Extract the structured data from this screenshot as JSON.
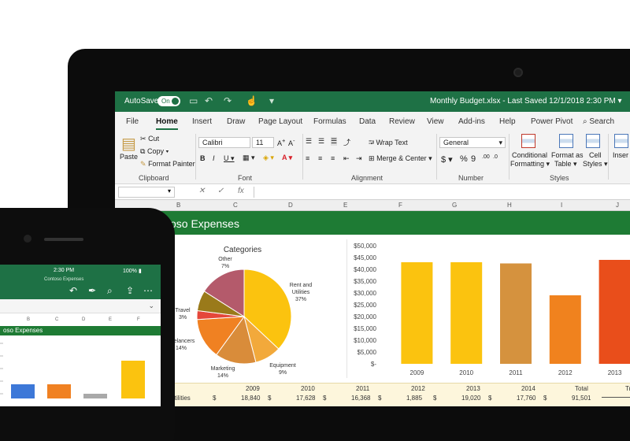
{
  "laptop": {
    "titlebar": {
      "autosave_label": "AutoSave",
      "autosave_state": "On",
      "document_title": "Monthly Budget.xlsx  -  Last Saved 12/1/2018 2:30 PM"
    },
    "tabs": [
      "File",
      "Home",
      "Insert",
      "Draw",
      "Page Layout",
      "Formulas",
      "Data",
      "Review",
      "View",
      "Add-ins",
      "Help",
      "Power Pivot"
    ],
    "active_tab": "Home",
    "search_label": "Search",
    "ribbon": {
      "clipboard": {
        "group": "Clipboard",
        "paste": "Paste",
        "cut": "Cut",
        "copy": "Copy",
        "format_painter": "Format Painter"
      },
      "font": {
        "group": "Font",
        "font_name": "Calibri",
        "font_size": "11"
      },
      "alignment": {
        "group": "Alignment",
        "wrap_text": "Wrap Text",
        "merge_center": "Merge & Center"
      },
      "number": {
        "group": "Number",
        "format": "General"
      },
      "styles": {
        "group": "Styles",
        "conditional": "Conditional",
        "formatting": "Formatting",
        "format_as": "Format as",
        "table": "Table",
        "cell": "Cell",
        "cell_styles": "Styles",
        "insert": "Inser"
      }
    },
    "column_headers": [
      "B",
      "C",
      "D",
      "E",
      "F",
      "G",
      "H",
      "I",
      "J"
    ],
    "banner_title": "oso Expenses",
    "pie": {
      "title": "Categories",
      "labels": [
        "Other",
        "7%",
        "Rent and",
        "Utilities",
        "37%",
        "Equipment",
        "9%",
        "Marketing",
        "14%",
        "elancers",
        "14%",
        "Travel",
        "3%"
      ]
    },
    "table": {
      "years": [
        "2009",
        "2010",
        "2011",
        "2012",
        "2013",
        "2014",
        "Total",
        "Tr"
      ],
      "row_label": "Utilities",
      "row_values": [
        "18,840",
        "17,628",
        "16,368",
        "1,885",
        "19,020",
        "17,760",
        "91,501"
      ],
      "currency": "$"
    }
  },
  "phone": {
    "time": "2:30 PM",
    "battery": "100%",
    "file_name": "Contoso Expenses",
    "column_headers": [
      "B",
      "C",
      "D",
      "E",
      "F"
    ],
    "banner_title": "oso Expenses"
  },
  "chart_data": {
    "type": "bar",
    "categories": [
      "2009",
      "2010",
      "2011",
      "2012",
      "2013"
    ],
    "values": [
      43000,
      43000,
      42500,
      29000,
      44000
    ],
    "colors": [
      "#fbc30f",
      "#fbc30f",
      "#d5923e",
      "#f0821e",
      "#e94e1b"
    ],
    "y_ticks": [
      "$-",
      "$5,000",
      "$10,000",
      "$15,000",
      "$20,000",
      "$25,000",
      "$30,000",
      "$35,000",
      "$40,000",
      "$45,000",
      "$50,000"
    ],
    "ylim": [
      0,
      50000
    ],
    "pie_slices": [
      {
        "label": "Rent and Utilities",
        "value": 37,
        "color": "#fbc30f"
      },
      {
        "label": "Equipment",
        "value": 9,
        "color": "#f2a93b"
      },
      {
        "label": "Marketing",
        "value": 14,
        "color": "#d98c3a"
      },
      {
        "label": "Freelancers",
        "value": 14,
        "color": "#f08122"
      },
      {
        "label": "Travel",
        "value": 3,
        "color": "#e5473a"
      },
      {
        "label": "Other",
        "value": 7,
        "color": "#9a7a1a"
      },
      {
        "label": "",
        "value": 16,
        "color": "#b45a6b"
      }
    ],
    "phone_bars": [
      {
        "value": 12,
        "color": "#3d78d8"
      },
      {
        "value": 12,
        "color": "#f08122"
      },
      {
        "value": 4,
        "color": "#a9a9a9"
      },
      {
        "value": 32,
        "color": "#fbc30f"
      }
    ]
  }
}
